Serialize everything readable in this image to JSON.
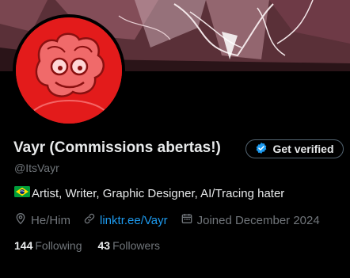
{
  "profile": {
    "display_name": "Vayr (Commissions abertas!)",
    "handle": "@ItsVayr",
    "bio_flag": "brazil-flag",
    "bio_text": "Artist, Writer, Graphic Designer, AI/Tracing hater",
    "pronouns": "He/Him",
    "link": "linktr.ee/Vayr",
    "joined": "Joined December 2024",
    "following_count": "144",
    "following_label": "Following",
    "followers_count": "43",
    "followers_label": "Followers"
  },
  "actions": {
    "get_verified_label": "Get verified"
  },
  "icons": {
    "location": "location-icon",
    "link": "link-icon",
    "calendar": "calendar-icon",
    "verified": "verified-badge-icon"
  },
  "colors": {
    "background": "#000000",
    "text_primary": "#e7e9ea",
    "text_secondary": "#71767b",
    "link": "#1d9bf0",
    "avatar_bg": "#e31b1b"
  }
}
